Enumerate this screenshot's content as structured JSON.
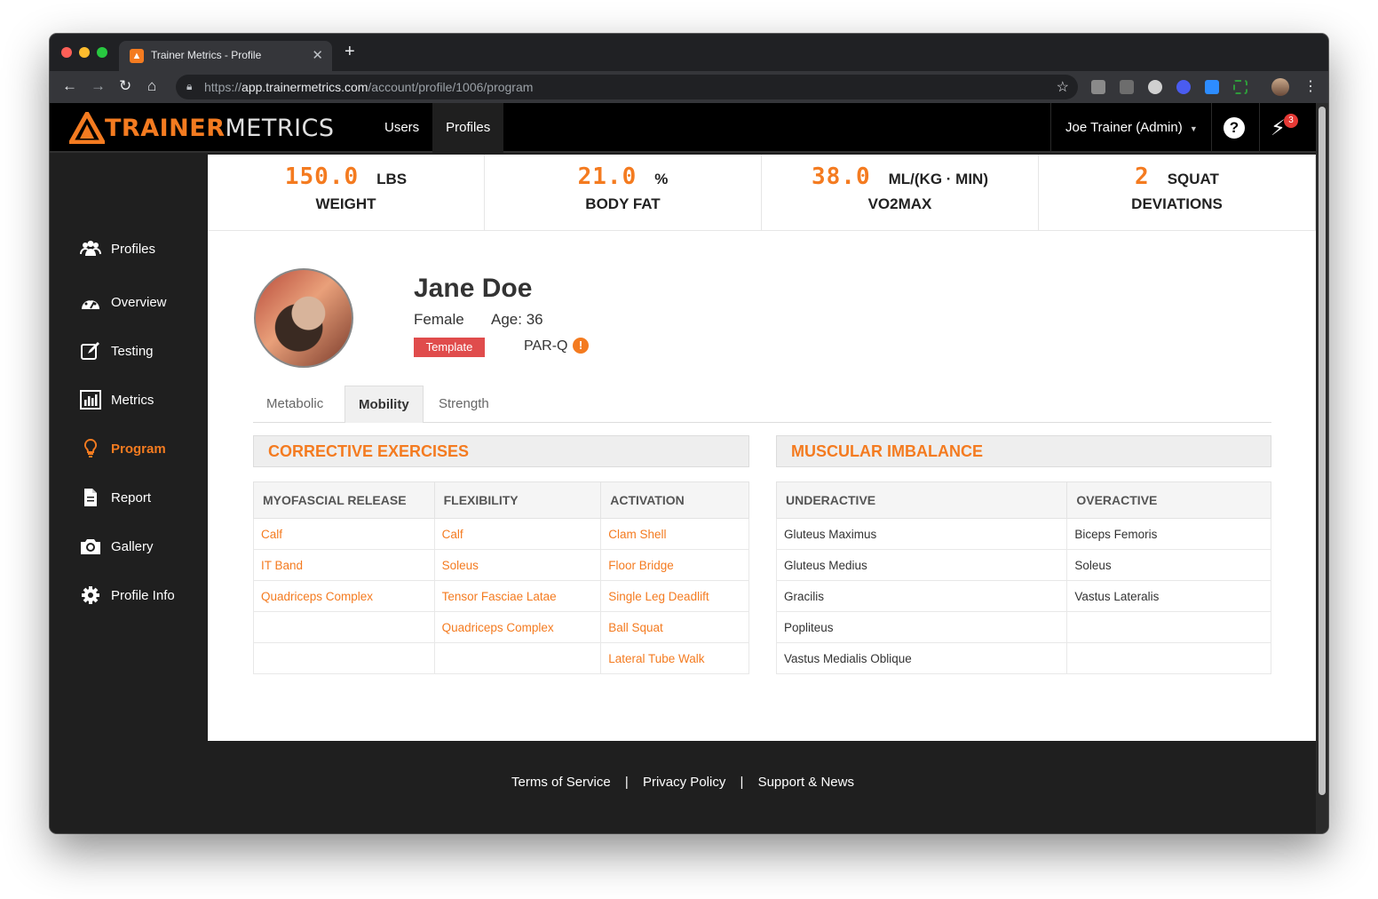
{
  "browser": {
    "tab_title": "Trainer Metrics - Profile",
    "url_scheme": "https://",
    "url_host": "app.trainermetrics.com",
    "url_path": "/account/profile/1006/program"
  },
  "header": {
    "logo_part1": "TRAINER",
    "logo_part2": "METRICS",
    "nav": [
      "Users",
      "Profiles"
    ],
    "user_menu": "Joe Trainer (Admin)",
    "notifications_count": "3"
  },
  "sidebar": {
    "items": [
      {
        "label": "Profiles",
        "icon": "users-icon"
      },
      {
        "label": "Overview",
        "icon": "dashboard-icon"
      },
      {
        "label": "Testing",
        "icon": "edit-icon"
      },
      {
        "label": "Metrics",
        "icon": "bar-chart-icon"
      },
      {
        "label": "Program",
        "icon": "lightbulb-icon"
      },
      {
        "label": "Report",
        "icon": "document-icon"
      },
      {
        "label": "Gallery",
        "icon": "camera-icon"
      },
      {
        "label": "Profile Info",
        "icon": "gear-icon"
      }
    ]
  },
  "stats": [
    {
      "value": "150.0",
      "unit": "LBS",
      "label": "WEIGHT"
    },
    {
      "value": "21.0",
      "unit": "%",
      "label": "BODY FAT"
    },
    {
      "value": "38.0",
      "unit": "ML/(KG · MIN)",
      "label": "VO2MAX"
    },
    {
      "value": "2",
      "unit": "SQUAT",
      "label": "DEVIATIONS"
    }
  ],
  "profile": {
    "name": "Jane Doe",
    "gender": "Female",
    "age": "Age: 36",
    "badge": "Template",
    "parq": "PAR-Q"
  },
  "tabs": [
    "Metabolic",
    "Mobility",
    "Strength"
  ],
  "corrective": {
    "title": "CORRECTIVE EXERCISES",
    "headers": [
      "MYOFASCIAL RELEASE",
      "FLEXIBILITY",
      "ACTIVATION"
    ],
    "rows": [
      [
        "Calf",
        "Calf",
        "Clam Shell"
      ],
      [
        "IT Band",
        "Soleus",
        "Floor Bridge"
      ],
      [
        "Quadriceps Complex",
        "Tensor Fasciae Latae",
        "Single Leg Deadlift"
      ],
      [
        "",
        "Quadriceps Complex",
        "Ball Squat"
      ],
      [
        "",
        "",
        "Lateral Tube Walk"
      ]
    ]
  },
  "imbalance": {
    "title": "MUSCULAR IMBALANCE",
    "headers": [
      "UNDERACTIVE",
      "OVERACTIVE"
    ],
    "rows": [
      [
        "Gluteus Maximus",
        "Biceps Femoris"
      ],
      [
        "Gluteus Medius",
        "Soleus"
      ],
      [
        "Gracilis",
        "Vastus Lateralis"
      ],
      [
        "Popliteus",
        ""
      ],
      [
        "Vastus Medialis Oblique",
        ""
      ]
    ]
  },
  "footer": {
    "links": [
      "Terms of Service",
      "Privacy Policy",
      "Support & News"
    ],
    "separator": "|"
  }
}
